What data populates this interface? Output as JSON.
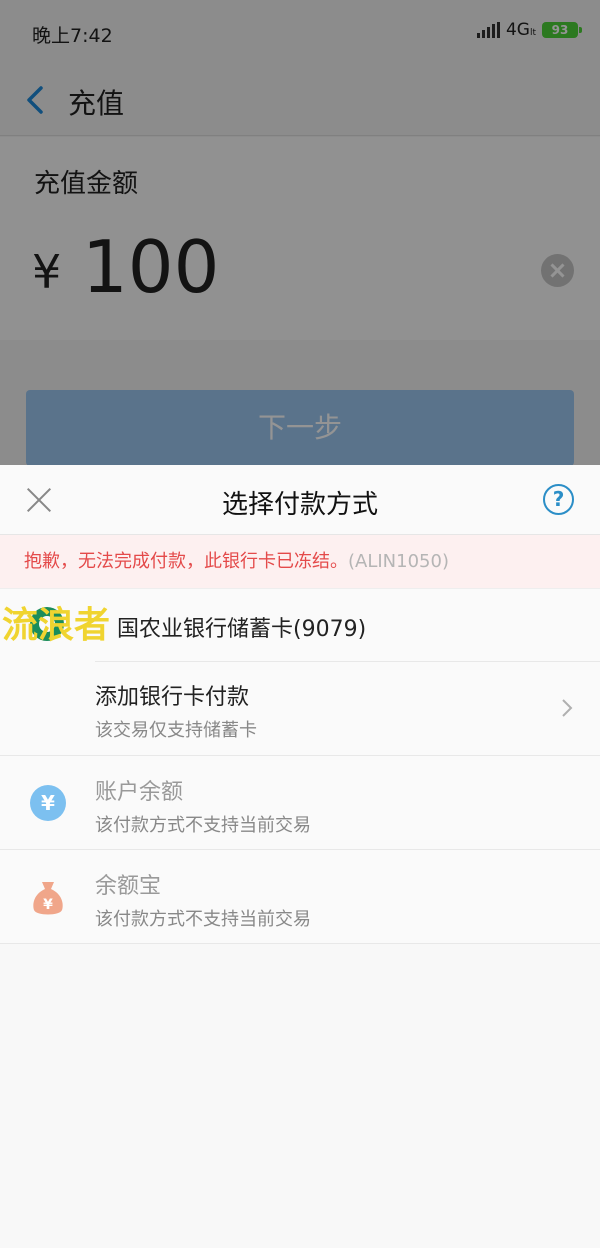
{
  "status_bar": {
    "time": "晚上7:42",
    "network": "4G",
    "network_sub": "lt",
    "battery": "93"
  },
  "nav": {
    "title": "充值"
  },
  "amount": {
    "label": "充值金额",
    "currency": "¥",
    "value": "100"
  },
  "next_button": "下一步",
  "sheet": {
    "title": "选择付款方式",
    "help": "?",
    "error": {
      "message": "抱歉，无法完成付款，此银行卡已冻结。",
      "code": "(ALIN1050)"
    },
    "watermark": "流浪者",
    "bank": {
      "name": "国农业银行储蓄卡(9079)"
    },
    "options": [
      {
        "title": "添加银行卡付款",
        "subtitle": "该交易仅支持储蓄卡"
      },
      {
        "title": "账户余额",
        "subtitle": "该付款方式不支持当前交易",
        "icon": "yen-icon"
      },
      {
        "title": "余额宝",
        "subtitle": "该付款方式不支持当前交易",
        "icon": "money-bag-icon"
      }
    ]
  },
  "colors": {
    "accent": "#2b8ec7",
    "error": "#e44a4a",
    "button": "#9cc7f0",
    "bank_green": "#1b8d5b"
  }
}
